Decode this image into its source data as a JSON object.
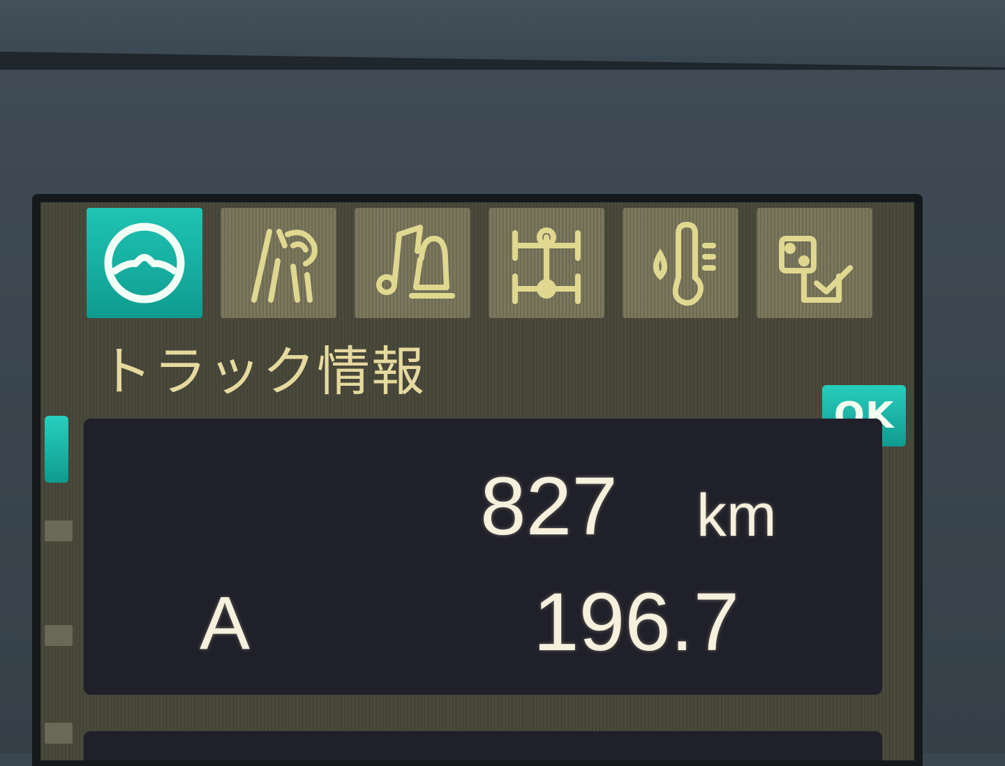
{
  "screen": {
    "title": "トラック情報",
    "ok_label": "OK",
    "tabs": [
      {
        "id": "truck-info",
        "icon": "steering-wheel-icon",
        "active": true
      },
      {
        "id": "lights",
        "icon": "headlight-icon",
        "active": false
      },
      {
        "id": "sound",
        "icon": "music-bell-icon",
        "active": false
      },
      {
        "id": "axles",
        "icon": "axle-icon",
        "active": false
      },
      {
        "id": "temperature",
        "icon": "thermometer-drop-icon",
        "active": false
      },
      {
        "id": "settings",
        "icon": "settings-check-icon",
        "active": false
      }
    ],
    "colors": {
      "accent": "#19b5a6",
      "inactive_tab": "#7b785d",
      "panel": "#20202a",
      "text": "#f6f0dc",
      "title_text": "#e6d99e"
    }
  },
  "trip": {
    "distance_value": "827",
    "distance_unit": "km",
    "trip_label": "A",
    "trip_value": "196.7"
  }
}
